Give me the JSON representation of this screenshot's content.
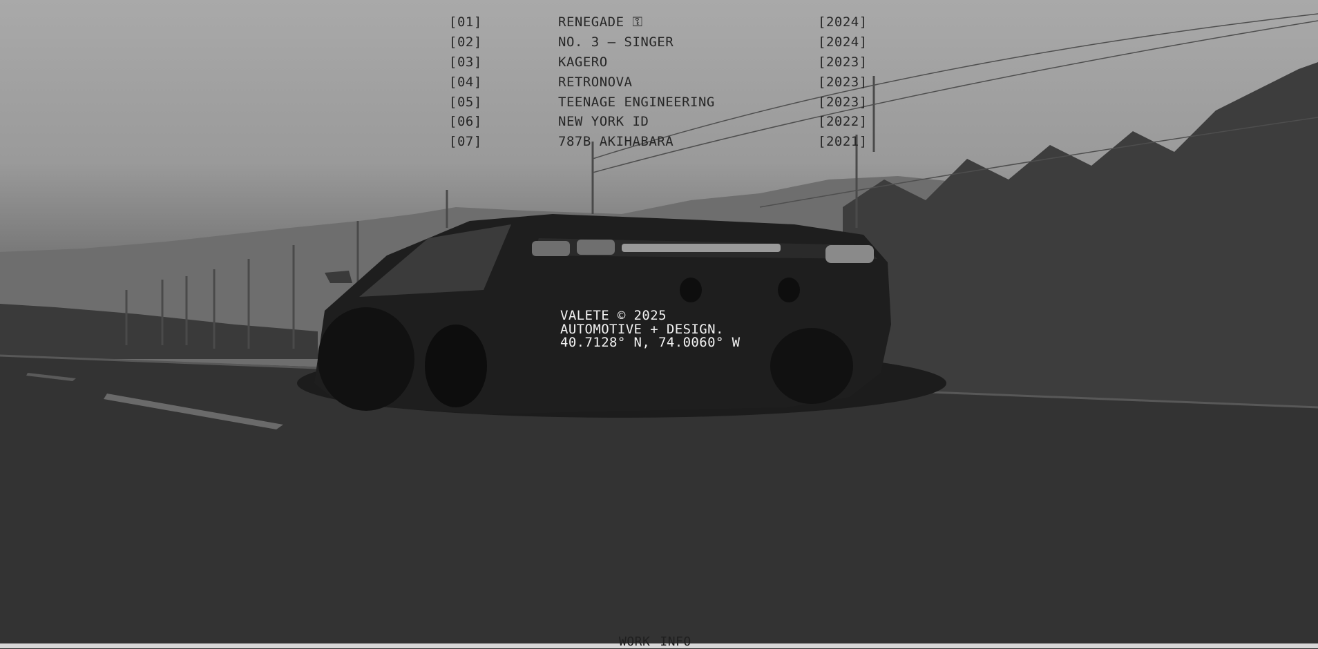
{
  "projects": [
    {
      "index": "[01]",
      "name": "RENEGADE ⚿",
      "year": "[2024]"
    },
    {
      "index": "[02]",
      "name": "NO. 3 — SINGER",
      "year": "[2024]"
    },
    {
      "index": "[03]",
      "name": "KAGERO",
      "year": "[2023]"
    },
    {
      "index": "[04]",
      "name": "RETRONOVA",
      "year": "[2023]"
    },
    {
      "index": "[05]",
      "name": "TEENAGE ENGINEERING",
      "year": "[2023]"
    },
    {
      "index": "[06]",
      "name": "NEW YORK ID",
      "year": "[2022]"
    },
    {
      "index": "[07]",
      "name": "787B AKIHABARA",
      "year": "[2021]"
    }
  ],
  "info": {
    "line1": "VALETE © 2025",
    "line2": "AUTOMOTIVE + DESIGN.",
    "line3": "40.7128° N, 74.0060° W"
  },
  "nav": {
    "work": "WORK",
    "info": "INFO"
  },
  "colors": {
    "text_dark": "#262626",
    "text_light": "#f2f2f2"
  }
}
